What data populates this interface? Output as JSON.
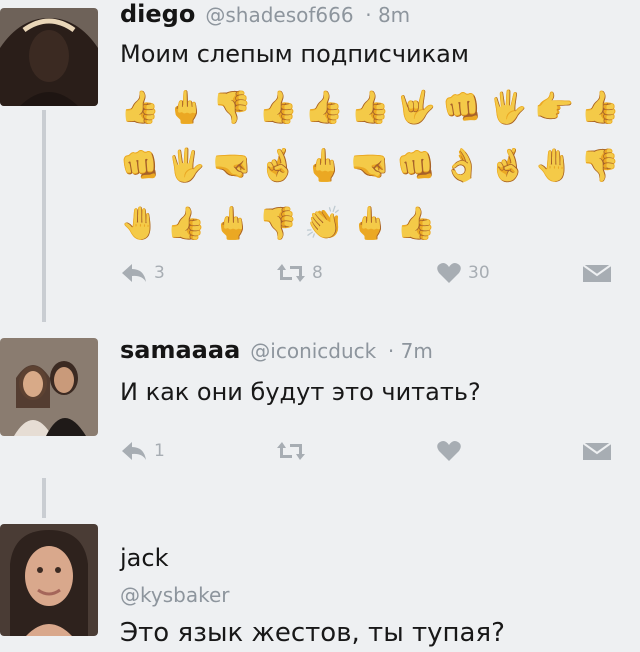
{
  "tweets": [
    {
      "name": "diego",
      "handle": "@shadesof666",
      "time": "· 8m",
      "text": "Моим слепым подписчикам",
      "emoji_rows": [
        [
          "👍",
          "🖕",
          "👎",
          "👍",
          "👍",
          "👍",
          "🤟",
          "👊",
          "🖐",
          "👉",
          "👍"
        ],
        [
          "👊",
          "🖐",
          "🤜",
          "🤞",
          "🖕",
          "🤜",
          "👊",
          "👌",
          "🤞",
          "🤚",
          "👎"
        ],
        [
          "🤚",
          "👍",
          "🖕",
          "👎",
          "👏",
          "🖕",
          "👍"
        ]
      ],
      "actions": {
        "reply_count": "3",
        "retweet_count": "8",
        "like_count": "30"
      },
      "colors": {
        "avatar_bg": "#5a4a3f",
        "avatar_face": "#3b2a22"
      }
    },
    {
      "name": "samaaaa",
      "handle": "@iconicduck",
      "time": "· 7m",
      "text": "И как они будут это читать?",
      "actions": {
        "reply_count": "1",
        "retweet_count": "",
        "like_count": ""
      },
      "colors": {
        "avatar_bg": "#7b6a5c",
        "avatar_face": "#c99a7a"
      }
    },
    {
      "name": "jack",
      "handle": "@kysbaker",
      "text": "Это язык жестов, ты тупая?",
      "colors": {
        "avatar_bg": "#3a2f2b",
        "avatar_face": "#d9a88c"
      }
    }
  ],
  "colors": {
    "background": "#eef0f2",
    "action_icon": "#a7adb3",
    "handle": "#8d959d",
    "thread_line": "#c9cdd2"
  },
  "icons": [
    "reply-icon",
    "retweet-icon",
    "like-icon",
    "direct-message-icon"
  ]
}
